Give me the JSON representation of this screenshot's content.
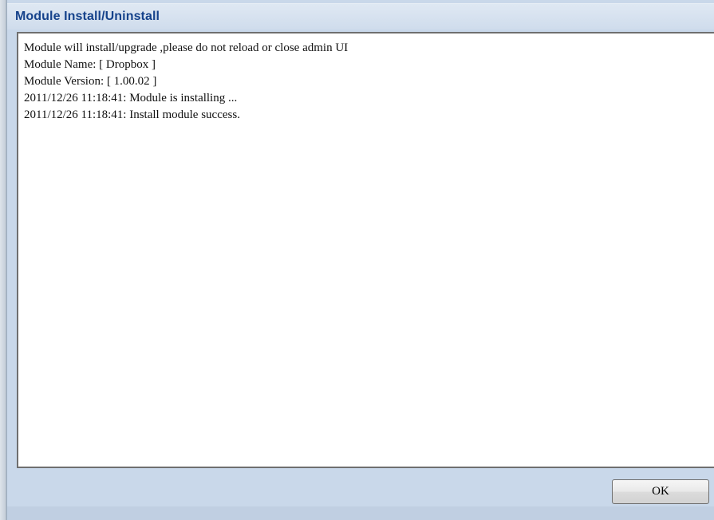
{
  "dialog": {
    "title": "Module Install/Uninstall"
  },
  "log": {
    "lines": [
      "Module will install/upgrade ,please do not reload or close admin UI",
      "Module Name: [ Dropbox ]",
      "Module Version: [ 1.00.02 ]",
      "2011/12/26 11:18:41: Module is installing ...",
      "2011/12/26 11:18:41: Install module success."
    ]
  },
  "buttons": {
    "ok_label": "OK"
  },
  "colors": {
    "title_text": "#15428b",
    "dialog_background": "#c9d8ea",
    "log_border": "#6f6f6f"
  }
}
